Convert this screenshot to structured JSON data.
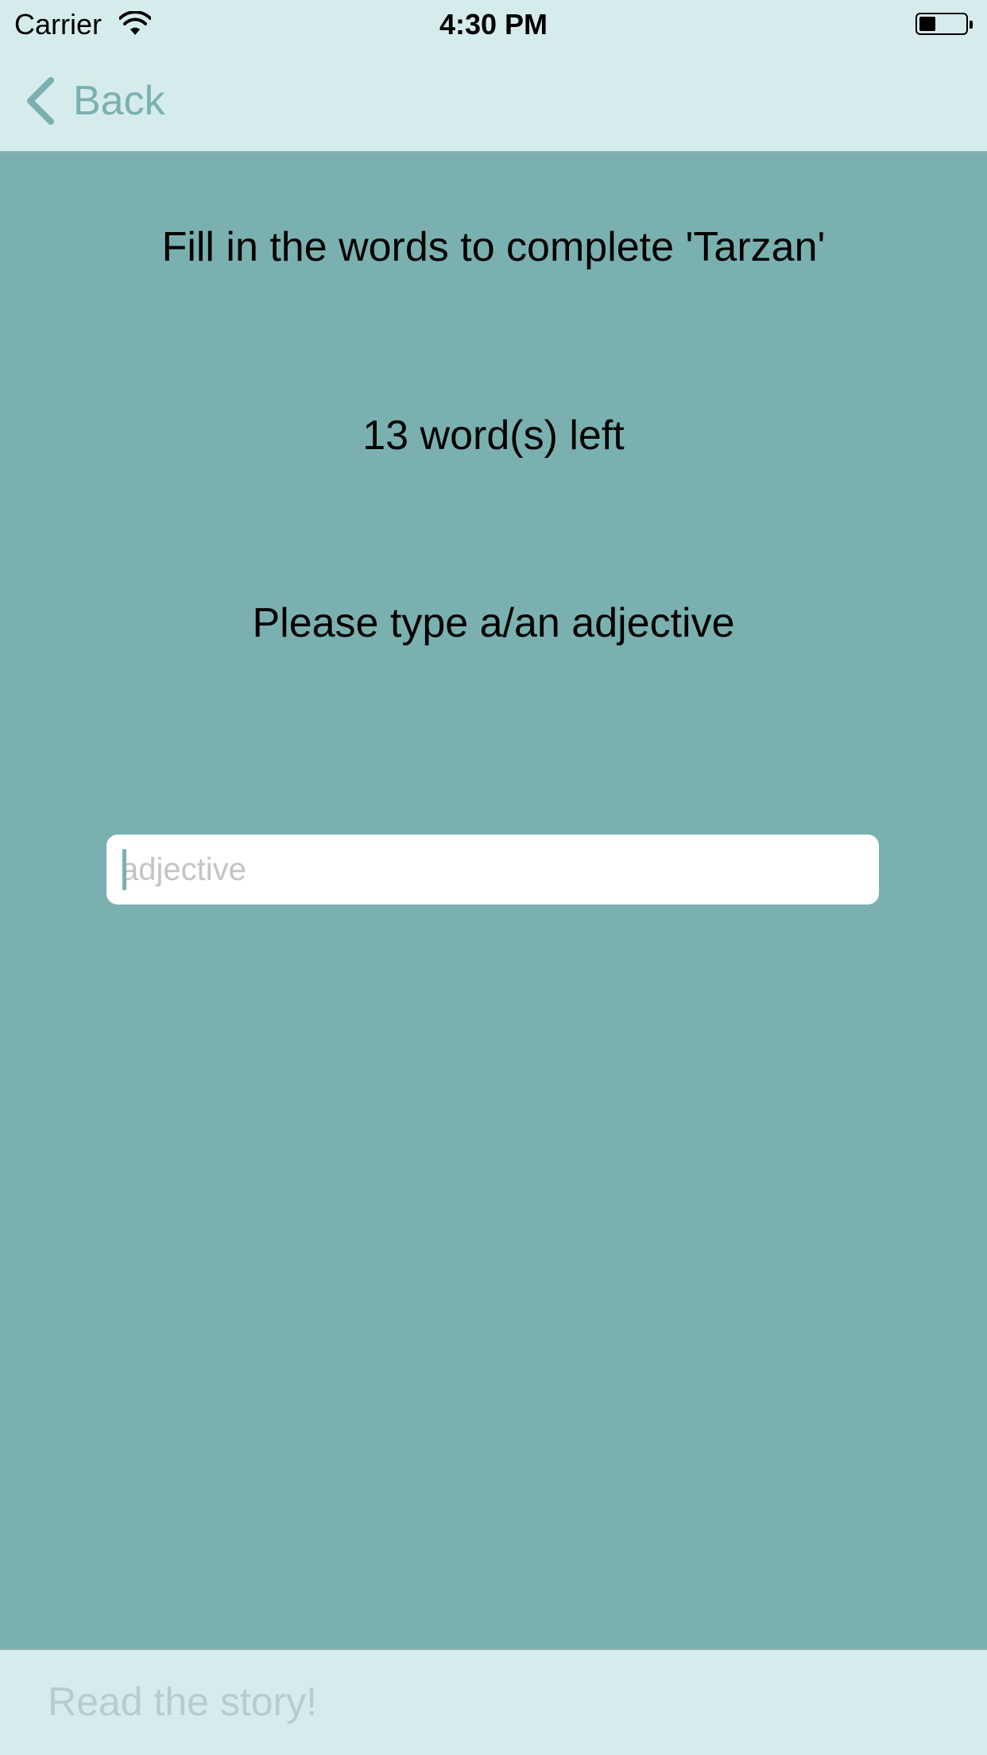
{
  "status_bar": {
    "carrier": "Carrier",
    "time": "4:30 PM",
    "battery_level": 0.35,
    "icons": [
      "wifi-icon",
      "battery-icon"
    ]
  },
  "nav": {
    "back_label": "Back",
    "back_icon": "chevron-left-icon"
  },
  "content": {
    "title": "Fill in the words to complete 'Tarzan'",
    "words_left": "13 word(s) left",
    "prompt": "Please type a/an adjective",
    "input": {
      "value": "",
      "placeholder": "adjective"
    }
  },
  "toolbar": {
    "read_story_label": "Read the story!"
  },
  "colors": {
    "background": "#7ab1b0",
    "bars": "#d6ebec",
    "accent": "#7ab1b0",
    "disabled_text": "#b9cbcc"
  }
}
